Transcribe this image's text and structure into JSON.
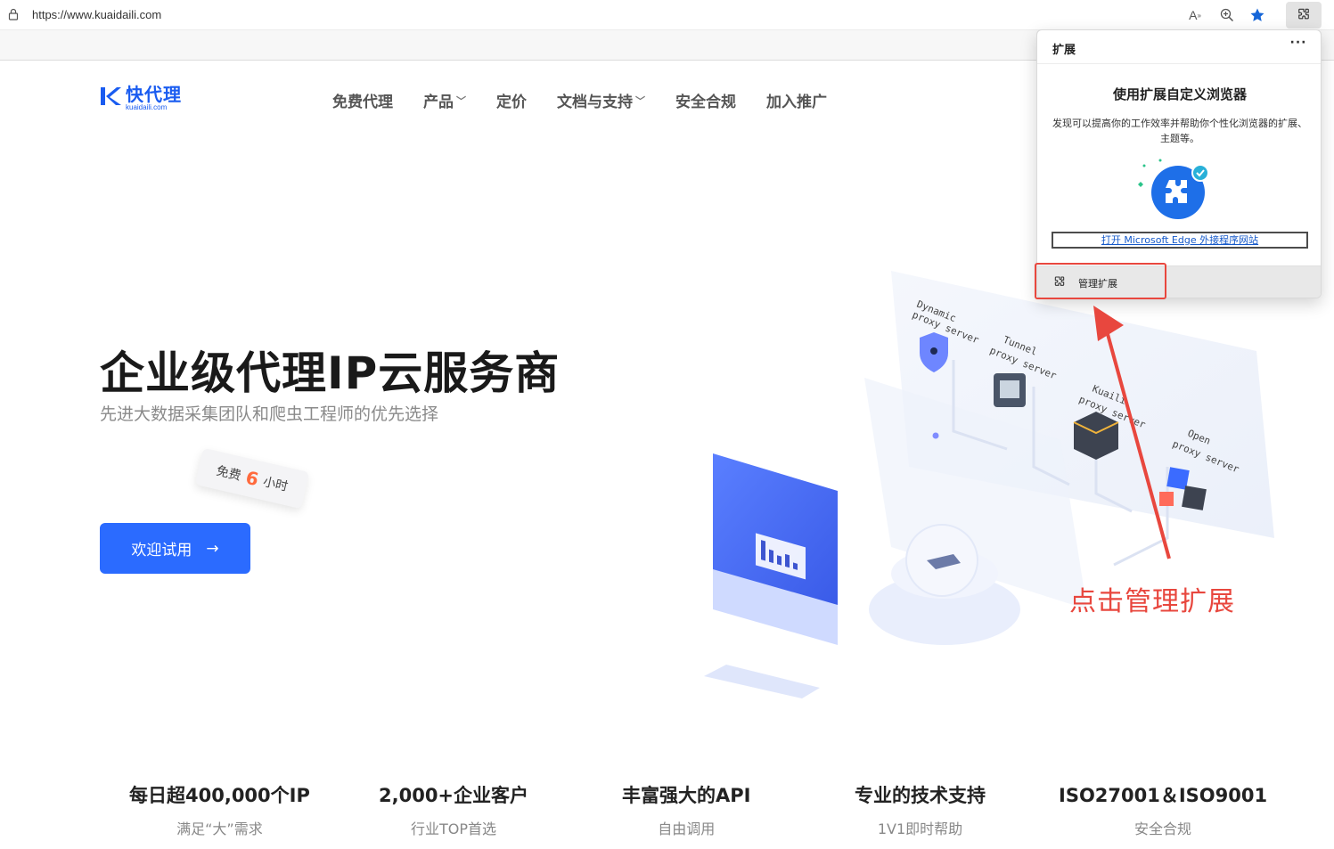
{
  "browser": {
    "url": "https://www.kuaidaili.com",
    "read_aloud_glyph": "A",
    "icons": [
      "lock-icon",
      "read-aloud-icon",
      "zoom-icon",
      "favorite-star-icon",
      "extensions-puzzle-icon"
    ]
  },
  "site": {
    "logo": {
      "cn": "快代理",
      "en": "kuaidaili.com"
    },
    "nav": [
      {
        "label": "免费代理",
        "dropdown": false
      },
      {
        "label": "产品",
        "dropdown": true
      },
      {
        "label": "定价",
        "dropdown": false
      },
      {
        "label": "文档与支持",
        "dropdown": true
      },
      {
        "label": "安全合规",
        "dropdown": false
      },
      {
        "label": "加入推广",
        "dropdown": false
      }
    ],
    "hero": {
      "title": "企业级代理IP云服务商",
      "subtitle": "先进大数据采集团队和爬虫工程师的优先选择",
      "badge": {
        "prefix": "免费",
        "number": "6",
        "suffix": "小时"
      },
      "cta": {
        "label": "欢迎试用",
        "arrow": "→"
      }
    },
    "illustration": {
      "labels": [
        "Dynamic",
        "proxy server",
        "Tunnel",
        "proxy server",
        "Kuaili",
        "proxy server",
        "Open",
        "proxy server"
      ]
    },
    "stats": [
      {
        "title": "每日超400,000个IP",
        "sub": "满足“大”需求"
      },
      {
        "title": "2,000+企业客户",
        "sub": "行业TOP首选"
      },
      {
        "title": "丰富强大的API",
        "sub": "自由调用"
      },
      {
        "title": "专业的技术支持",
        "sub": "1V1即时帮助"
      },
      {
        "title": "ISO27001＆ISO9001",
        "sub": "安全合规"
      }
    ]
  },
  "extensions_popup": {
    "title": "扩展",
    "more": "···",
    "heading": "使用扩展自定义浏览器",
    "description": "发现可以提高你的工作效率并帮助你个性化浏览器的扩展、主题等。",
    "link": "打开 Microsoft Edge 外接程序网站",
    "manage": "管理扩展"
  },
  "annotation": {
    "text": "点击管理扩展",
    "color": "#e8473e"
  },
  "colors": {
    "brand": "#1a5cf0",
    "cta": "#2b6bff",
    "badge_number": "#ff6a3d",
    "link": "#1458c9"
  }
}
